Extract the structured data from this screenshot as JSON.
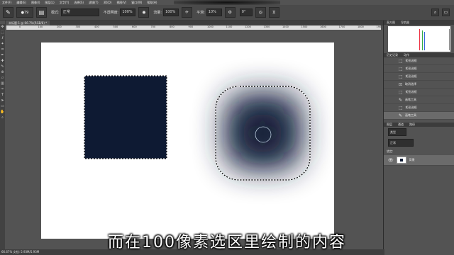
{
  "menubar": {
    "items": [
      "文件(F)",
      "编辑(E)",
      "图像(I)",
      "图层(L)",
      "文字(Y)",
      "选择(S)",
      "滤镜(T)",
      "3D(D)",
      "视图(V)",
      "窗口(W)",
      "帮助(H)"
    ]
  },
  "options": {
    "mode_label": "模式:",
    "mode_value": "正常",
    "opacity_label": "不透明度:",
    "opacity_value": "100%",
    "flow_label": "流量:",
    "flow_value": "100%",
    "smooth_label": "平滑:",
    "smooth_value": "10%",
    "angle_value": "0°",
    "brush_size": "79"
  },
  "document": {
    "tab_label": "未标题-1 @ 66.7%(RGB/8) *"
  },
  "ruler": {
    "ticks": [
      "0",
      "100",
      "200",
      "300",
      "400",
      "500",
      "600",
      "700",
      "800",
      "900",
      "1000",
      "1100",
      "1200",
      "1300",
      "1400",
      "1500",
      "1600",
      "1700",
      "1800",
      "1900"
    ]
  },
  "panels": {
    "histogram_tabs": [
      "直方图",
      "导航器"
    ],
    "history_tabs": [
      "历史记录",
      "动作"
    ],
    "history": [
      {
        "label": "矩形选框",
        "icon": "rect-select-icon"
      },
      {
        "label": "矩形选框",
        "icon": "rect-select-icon"
      },
      {
        "label": "矩形选框",
        "icon": "rect-select-icon"
      },
      {
        "label": "取消选择",
        "icon": "deselect-icon"
      },
      {
        "label": "矩形选框",
        "icon": "rect-select-icon"
      },
      {
        "label": "画笔工具",
        "icon": "brush-icon"
      },
      {
        "label": "矩形选框",
        "icon": "rect-select-icon"
      },
      {
        "label": "画笔工具",
        "icon": "brush-icon"
      }
    ],
    "layers_tabs": [
      "图层",
      "通道",
      "路径"
    ],
    "layer_kind": "类型",
    "layer_blend": "正常",
    "layer_lock_label": "锁定:",
    "layers": [
      {
        "name": "背景"
      }
    ]
  },
  "status": {
    "text": "66.67%     文档: 5.93M/5.93M"
  },
  "subtitle": {
    "text": "而在100像素选区里绘制的内容"
  },
  "colors": {
    "fill": "#0e1a33",
    "canvas": "#ffffff",
    "ui": "#535353"
  }
}
